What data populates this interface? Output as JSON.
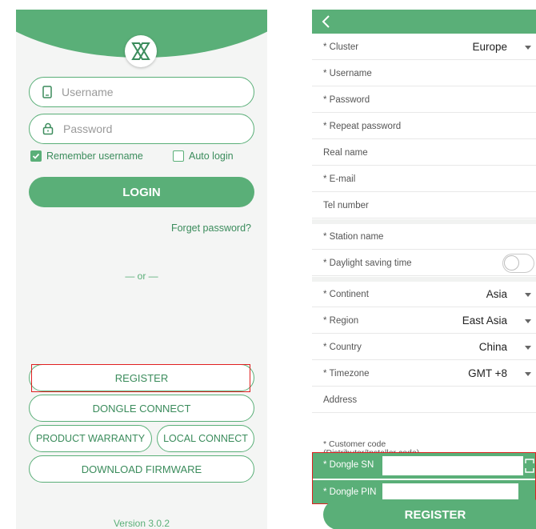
{
  "login": {
    "username_placeholder": "Username",
    "password_placeholder": "Password",
    "remember_label": "Remember username",
    "remember_checked": true,
    "autologin_label": "Auto login",
    "autologin_checked": false,
    "login_button": "LOGIN",
    "forget_link": "Forget password?",
    "or_text": "— or —",
    "register_button": "REGISTER",
    "dongle_connect_button": "DONGLE CONNECT",
    "product_warranty_button": "PRODUCT WARRANTY",
    "local_connect_button": "LOCAL CONNECT",
    "download_firmware_button": "DOWNLOAD FIRMWARE",
    "version": "Version 3.0.2"
  },
  "register": {
    "rows": {
      "cluster": {
        "label": "* Cluster",
        "value": "Europe"
      },
      "username": {
        "label": "* Username"
      },
      "password": {
        "label": "* Password"
      },
      "repeat_password": {
        "label": "* Repeat password"
      },
      "real_name": {
        "label": "Real name"
      },
      "email": {
        "label": "* E-mail"
      },
      "tel": {
        "label": "Tel number"
      },
      "station_name": {
        "label": "* Station name"
      },
      "daylight": {
        "label": "* Daylight saving time",
        "enabled": false
      },
      "continent": {
        "label": "* Continent",
        "value": "Asia"
      },
      "region": {
        "label": "* Region",
        "value": "East Asia"
      },
      "country": {
        "label": "* Country",
        "value": "China"
      },
      "timezone": {
        "label": "* Timezone",
        "value": "GMT +8"
      },
      "address": {
        "label": "Address"
      }
    },
    "customer_code_line1": "* Customer code",
    "customer_code_line2": "(Distributor/Installer code)",
    "dongle_sn_label": "* Dongle SN",
    "dongle_pin_label": "* Dongle PIN",
    "register_button": "REGISTER"
  },
  "colors": {
    "accent": "#5aaf78",
    "accent_text": "#3b8c5c",
    "highlight": "#e02020"
  }
}
